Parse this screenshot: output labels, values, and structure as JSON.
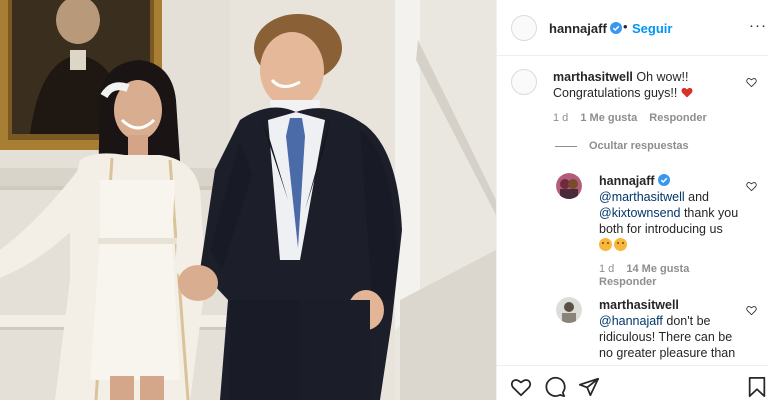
{
  "post": {
    "username": "hannajaff",
    "separator": "•",
    "follow_label": "Seguir",
    "more_label": "···"
  },
  "comments": [
    {
      "username": "marthasitwell",
      "text": "Oh wow!! Congratulations guys!!",
      "time": "1 d",
      "likes": "1 Me gusta",
      "reply_label": "Responder"
    }
  ],
  "hide_replies_label": "Ocultar respuestas",
  "replies": [
    {
      "username": "hannajaff",
      "mention1": "@marthasitwell",
      "text1": " and ",
      "mention2": "@kixtownsend",
      "text2": " thank you both for introducing us",
      "time": "1 d",
      "likes": "14 Me gusta",
      "reply_label": "Responder"
    },
    {
      "username": "marthasitwell",
      "mention": "@hannajaff",
      "text": " don't be ridiculous! There can be no greater pleasure than"
    }
  ],
  "icons": [
    "verified-badge-icon",
    "heart-icon",
    "comment-icon",
    "share-icon",
    "bookmark-icon"
  ],
  "colors": {
    "link": "#0095f6",
    "mention": "#00376b",
    "meta": "#8e8e8e",
    "heart": "#ed4956"
  }
}
